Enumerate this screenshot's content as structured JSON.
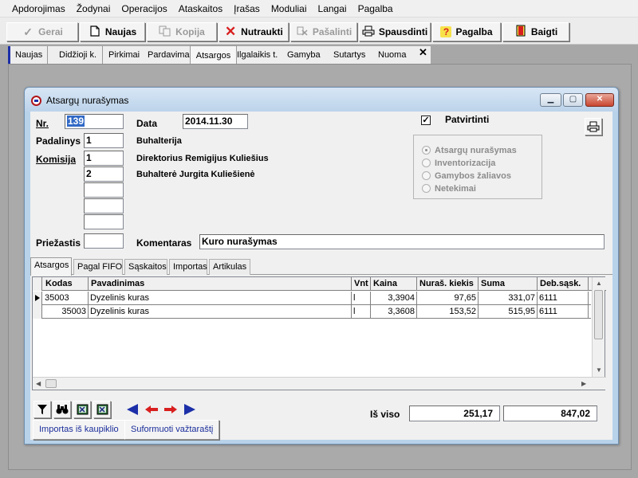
{
  "menu": [
    "Apdorojimas",
    "Žodynai",
    "Operacijos",
    "Ataskaitos",
    "Įrašas",
    "Moduliai",
    "Langai",
    "Pagalba"
  ],
  "toolbar": {
    "gerai": "Gerai",
    "naujas": "Naujas",
    "kopija": "Kopija",
    "nutraukti": "Nutraukti",
    "pasalinti": "Pašalinti",
    "spausdinti": "Spausdinti",
    "pagalba": "Pagalba",
    "baigti": "Baigti"
  },
  "tabs": [
    "Naujas",
    "Didžioji k.",
    "Pirkimai",
    "Pardavimai",
    "Atsargos",
    "Ilgalaikis t.",
    "Gamyba",
    "Sutartys",
    "Nuoma"
  ],
  "tabs_close": "✕",
  "window": {
    "title": "Atsargų nurašymas"
  },
  "form": {
    "nr_label": "Nr.",
    "nr_value": "139",
    "data_label": "Data",
    "data_value": "2014.11.30",
    "patvirtinti_label": "Patvirtinti",
    "patvirtinti_checked": "✓",
    "padalinys_label": "Padalinys",
    "padalinys_value": "1",
    "padalinys_name": "Buhalterija",
    "komisija_label": "Komisija",
    "komisija_1": "1",
    "komisija_1_name": "Direktorius Remigijus Kuliešius",
    "komisija_2": "2",
    "komisija_2_name": "Buhalterė Jurgita Kuliešienė",
    "priezastis_label": "Priežastis",
    "komentaras_label": "Komentaras",
    "komentaras_value": "Kuro nurašymas"
  },
  "radio_options": [
    "Atsargų nurašymas",
    "Inventorizacija",
    "Gamybos žaliavos",
    "Netekimai"
  ],
  "inner_tabs": [
    "Atsargos",
    "Pagal FIFO",
    "Sąskaitos",
    "Importas",
    "Artikulas"
  ],
  "grid": {
    "columns": [
      "Kodas",
      "Pavadinimas",
      "Vnt",
      "Kaina",
      "Nuraš. kiekis",
      "Suma",
      "Deb.sąsk."
    ],
    "rows": [
      {
        "kodas": "35003",
        "pavadinimas": "Dyzelinis kuras",
        "vnt": "l",
        "kaina": "3,3904",
        "kiekis": "97,65",
        "suma": "331,07",
        "deb": "6111"
      },
      {
        "kodas": "35003",
        "pavadinimas": "Dyzelinis kuras",
        "vnt": "l",
        "kaina": "3,3608",
        "kiekis": "153,52",
        "suma": "515,95",
        "deb": "6111"
      }
    ]
  },
  "footer": {
    "is_viso_label": "Iš viso",
    "kiekis_total": "251,17",
    "suma_total": "847,02",
    "importas_btn": "Importas iš kaupiklio",
    "suformuoti_btn": "Suformuoti važtaraštį"
  },
  "colors": {
    "accent": "#1c2fa8",
    "close_red": "#d81e1e",
    "title_bar": "#bcd3ea"
  }
}
